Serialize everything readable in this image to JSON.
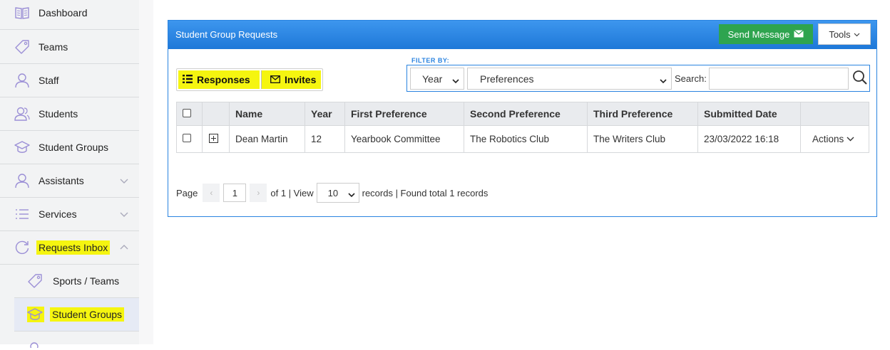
{
  "sidebar": {
    "items": [
      {
        "label": "Dashboard",
        "icon": "book-icon"
      },
      {
        "label": "Teams",
        "icon": "tag-icon"
      },
      {
        "label": "Staff",
        "icon": "user-icon"
      },
      {
        "label": "Students",
        "icon": "users-icon"
      },
      {
        "label": "Student Groups",
        "icon": "graduation-cap-icon"
      },
      {
        "label": "Assistants",
        "icon": "user-icon"
      },
      {
        "label": "Services",
        "icon": "list-icon"
      },
      {
        "label": "Requests Inbox",
        "icon": "refresh-icon"
      }
    ],
    "sub_items": [
      {
        "label": "Sports / Teams",
        "icon": "tag-icon"
      },
      {
        "label": "Student Groups",
        "icon": "graduation-cap-icon"
      }
    ]
  },
  "panel": {
    "title": "Student Group Requests",
    "send_message_label": "Send Message",
    "tools_label": "Tools"
  },
  "toggle": {
    "responses_label": "Responses",
    "invites_label": "Invites"
  },
  "filter": {
    "label": "FILTER BY:",
    "year_value": "Year",
    "preferences_value": "Preferences",
    "search_label": "Search:",
    "search_value": ""
  },
  "table": {
    "headers": [
      "Name",
      "Year",
      "First Preference",
      "Second Preference",
      "Third Preference",
      "Submitted Date"
    ],
    "rows": [
      {
        "name": "Dean Martin",
        "year": "12",
        "first": "Yearbook Committee",
        "second": "The Robotics Club",
        "third": "The Writers Club",
        "submitted": "23/03/2022 16:18",
        "actions": "Actions"
      }
    ]
  },
  "pager": {
    "page_label": "Page",
    "page_value": "1",
    "of_text": "of 1 | View",
    "view_value": "10",
    "records_text": "records | Found total 1 records"
  },
  "colors": {
    "accent": "#2a83e0",
    "send_button": "#2ea44f",
    "highlight": "#f5f510",
    "icon": "#9b8fd6"
  }
}
